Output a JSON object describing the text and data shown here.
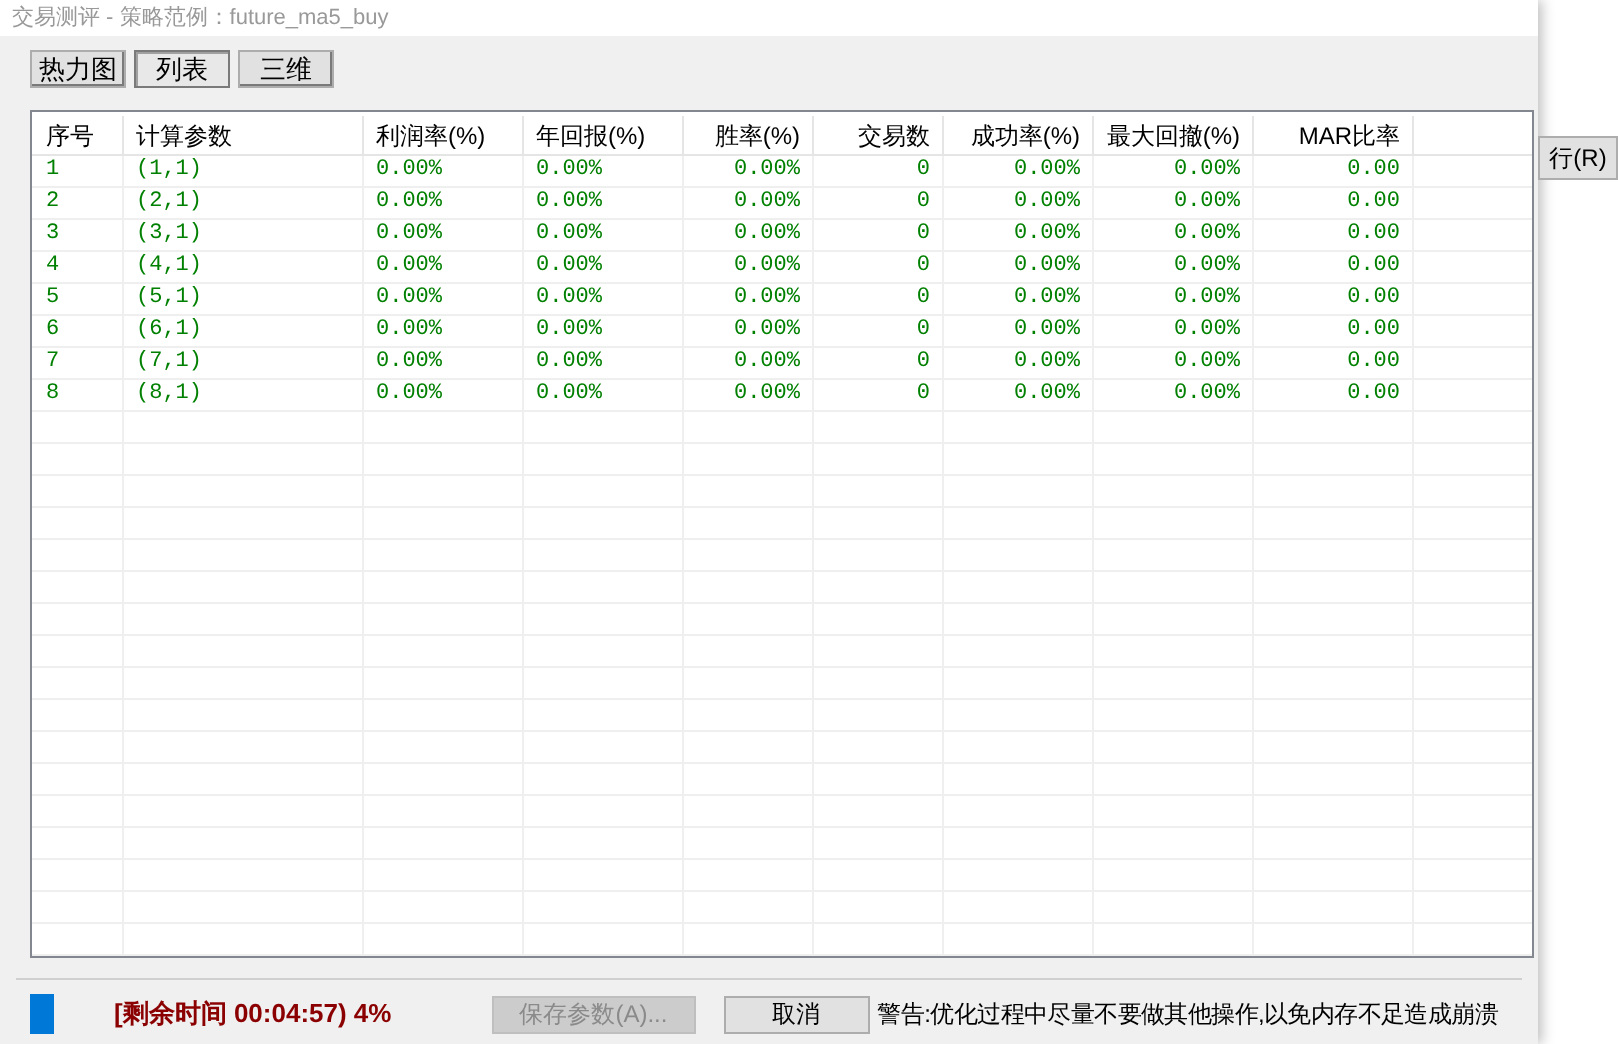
{
  "window": {
    "title": "交易测评 - 策略范例：future_ma5_buy"
  },
  "tabs": [
    {
      "label": "热力图",
      "selected": false
    },
    {
      "label": "列表",
      "selected": true
    },
    {
      "label": "三维",
      "selected": false
    }
  ],
  "table": {
    "columns": [
      "序号",
      "计算参数",
      "利润率(%)",
      "年回报(%)",
      "胜率(%)",
      "交易数",
      "成功率(%)",
      "最大回撤(%)",
      "MAR比率"
    ],
    "rows": [
      [
        "1",
        "(1,1)",
        "0.00%",
        "0.00%",
        "0.00%",
        "0",
        "0.00%",
        "0.00%",
        "0.00"
      ],
      [
        "2",
        "(2,1)",
        "0.00%",
        "0.00%",
        "0.00%",
        "0",
        "0.00%",
        "0.00%",
        "0.00"
      ],
      [
        "3",
        "(3,1)",
        "0.00%",
        "0.00%",
        "0.00%",
        "0",
        "0.00%",
        "0.00%",
        "0.00"
      ],
      [
        "4",
        "(4,1)",
        "0.00%",
        "0.00%",
        "0.00%",
        "0",
        "0.00%",
        "0.00%",
        "0.00"
      ],
      [
        "5",
        "(5,1)",
        "0.00%",
        "0.00%",
        "0.00%",
        "0",
        "0.00%",
        "0.00%",
        "0.00"
      ],
      [
        "6",
        "(6,1)",
        "0.00%",
        "0.00%",
        "0.00%",
        "0",
        "0.00%",
        "0.00%",
        "0.00"
      ],
      [
        "7",
        "(7,1)",
        "0.00%",
        "0.00%",
        "0.00%",
        "0",
        "0.00%",
        "0.00%",
        "0.00"
      ],
      [
        "8",
        "(8,1)",
        "0.00%",
        "0.00%",
        "0.00%",
        "0",
        "0.00%",
        "0.00%",
        "0.00"
      ]
    ]
  },
  "status": {
    "progress": {
      "level": 0.04
    },
    "progress_text": "[剩余时间 00:04:57) 4%",
    "save_button": {
      "label": "保存参数(A)...",
      "disabled": true
    },
    "cancel_button": {
      "label": "取消",
      "disabled": false
    },
    "warning": "警告:优化过程中尽量不要做其他操作,以免内存不足造成崩溃"
  },
  "background_window": {
    "button": "行(R)"
  }
}
